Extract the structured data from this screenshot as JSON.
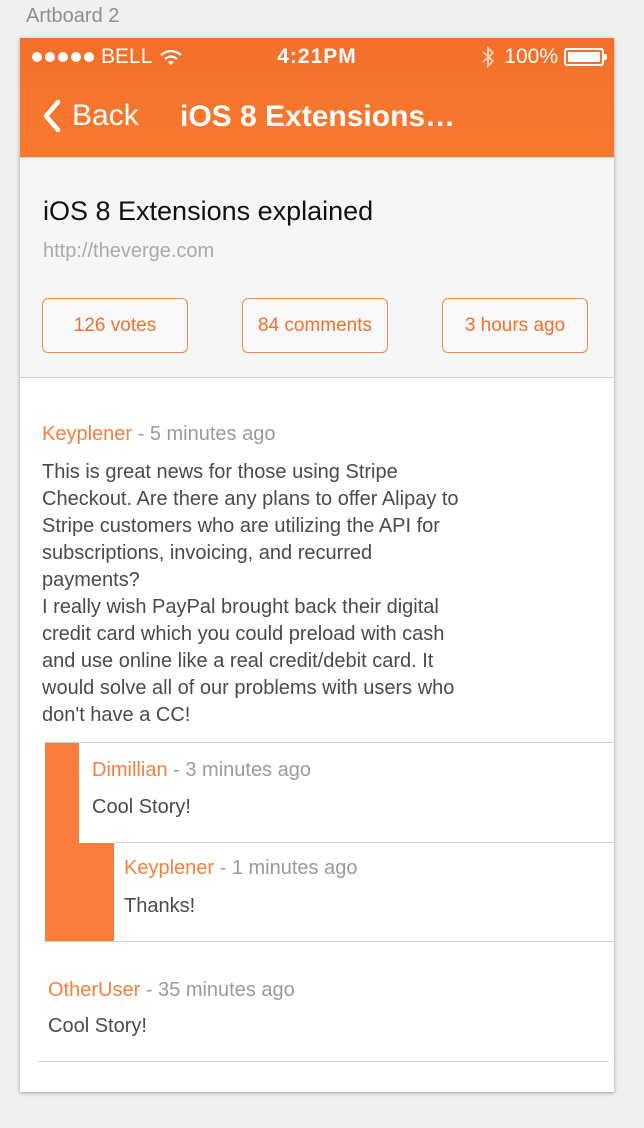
{
  "artboard_label": "Artboard 2",
  "status_bar": {
    "carrier": "BELL",
    "time": "4:21PM",
    "battery": "100%"
  },
  "nav": {
    "back_label": "Back",
    "title": "iOS 8 Extensions…"
  },
  "story": {
    "title": "iOS 8 Extensions explained",
    "url": "http://theverge.com",
    "votes": "126 votes",
    "comments": "84 comments",
    "time": "3 hours ago"
  },
  "comments": [
    {
      "user": "Keyplener",
      "meta": " - 5 minutes ago",
      "body": "This is great news for those using Stripe\nCheckout. Are there any plans to offer Alipay to\nStripe customers who are utilizing the API for\nsubscriptions, invoicing, and recurred\npayments?\nI really wish PayPal brought back their digital\ncredit card which you could preload with cash\nand use online like a real credit/debit card. It\nwould solve all of our problems with users who\ndon't have a CC!"
    },
    {
      "user": "Dimillian",
      "meta": " - 3 minutes ago",
      "body": "Cool Story!"
    },
    {
      "user": "Keyplener",
      "meta": " - 1 minutes ago",
      "body": "Thanks!"
    },
    {
      "user": "OtherUser",
      "meta": " - 35 minutes ago",
      "body": "Cool Story!"
    }
  ],
  "colors": {
    "accent": "#f26f2c",
    "thread_bar": "#fb7d3e"
  }
}
